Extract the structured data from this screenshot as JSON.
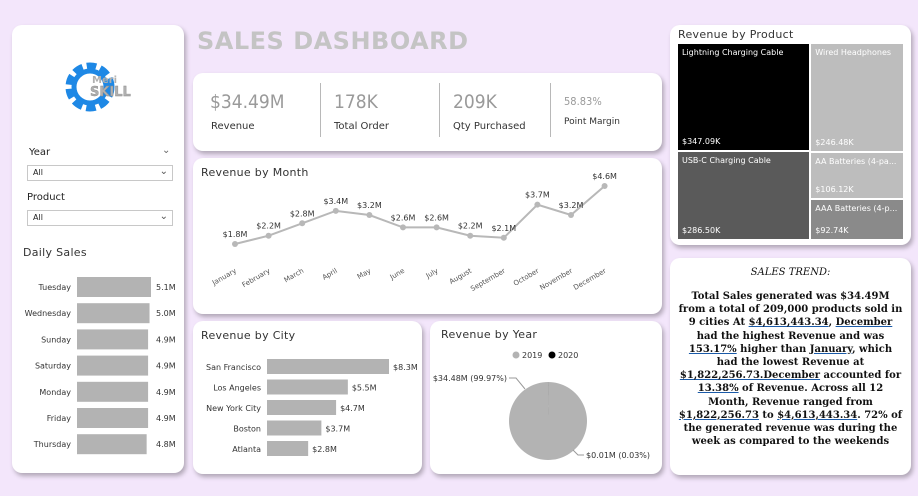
{
  "dashboard": {
    "title": "SALES DASHBOARD"
  },
  "logo": {
    "line1": "Meri",
    "line2": "SKILL"
  },
  "filters": {
    "year": {
      "label": "Year",
      "value": "All"
    },
    "product": {
      "label": "Product",
      "value": "All"
    }
  },
  "kpis": [
    {
      "value": "$34.49M",
      "label": "Revenue"
    },
    {
      "value": "178K",
      "label": "Total Order"
    },
    {
      "value": "209K",
      "label": "Qty Purchased"
    },
    {
      "value": "58.83%",
      "label": "Point Margin"
    }
  ],
  "colors": {
    "bar": "#b3b3b3",
    "line": "#b8b8b8",
    "bg": "#f3e6fb",
    "dark": "#000000",
    "pieMajor": "#b3b3b3",
    "pieMinor": "#000000"
  },
  "trend": {
    "title": "SALES TREND:",
    "segments": [
      {
        "t": "Total Sales generated was $34.49M from a total of 209,000 products sold in 9 cities At "
      },
      {
        "t": "$4,613,443.34",
        "u": true
      },
      {
        "t": ", "
      },
      {
        "t": "December",
        "u": true
      },
      {
        "t": " had the highest Revenue and was "
      },
      {
        "t": "153.17%",
        "u": true
      },
      {
        "t": " higher than "
      },
      {
        "t": "January",
        "u": true
      },
      {
        "t": ", which had the lowest Revenue at "
      },
      {
        "t": "$1,822,256.73.December",
        "u": true
      },
      {
        "t": " accounted for "
      },
      {
        "t": "13.38%",
        "u": true
      },
      {
        "t": " of Revenue. Across all 12 Month, Revenue ranged from "
      },
      {
        "t": "$1,822,256.73",
        "u": true
      },
      {
        "t": " to "
      },
      {
        "t": "$4,613,443.34",
        "u": true
      },
      {
        "t": ". 72% of the generated revenue was during the week as compared to the weekends"
      }
    ]
  },
  "chart_data": [
    {
      "id": "daily",
      "type": "bar",
      "orientation": "horizontal",
      "title": "Daily Sales",
      "categories": [
        "Tuesday",
        "Wednesday",
        "Sunday",
        "Saturday",
        "Monday",
        "Friday",
        "Thursday"
      ],
      "values": [
        5.1,
        5.0,
        4.9,
        4.9,
        4.9,
        4.9,
        4.8
      ],
      "labels": [
        "5.1M",
        "5.0M",
        "4.9M",
        "4.9M",
        "4.9M",
        "4.9M",
        "4.8M"
      ]
    },
    {
      "id": "month",
      "type": "line",
      "title": "Revenue by Month",
      "categories": [
        "January",
        "February",
        "March",
        "April",
        "May",
        "June",
        "July",
        "August",
        "September",
        "October",
        "November",
        "December"
      ],
      "values": [
        1.8,
        2.2,
        2.8,
        3.4,
        3.2,
        2.6,
        2.6,
        2.2,
        2.1,
        3.7,
        3.2,
        4.6
      ],
      "labels": [
        "$1.8M",
        "$2.2M",
        "$2.8M",
        "$3.4M",
        "$3.2M",
        "$2.6M",
        "$2.6M",
        "$2.2M",
        "$2.1M",
        "$3.7M",
        "$3.2M",
        "$4.6M"
      ]
    },
    {
      "id": "city",
      "type": "bar",
      "orientation": "horizontal",
      "title": "Revenue by City",
      "categories": [
        "San Francisco",
        "Los Angeles",
        "New York City",
        "Boston",
        "Atlanta"
      ],
      "values": [
        8.3,
        5.5,
        4.7,
        3.7,
        2.8
      ],
      "labels": [
        "$8.3M",
        "$5.5M",
        "$4.7M",
        "$3.7M",
        "$2.8M"
      ]
    },
    {
      "id": "year",
      "type": "pie",
      "title": "Revenue by Year",
      "legend": [
        "2019",
        "2020"
      ],
      "values": [
        34.48,
        0.01
      ],
      "labels": [
        "$34.48M (99.97%)",
        "$0.01M (0.03%)"
      ]
    },
    {
      "id": "product",
      "type": "treemap",
      "title": "Revenue by Product",
      "items": [
        {
          "name": "Lightning Charging Cable",
          "label": "$347.09K"
        },
        {
          "name": "Wired Headphones",
          "label": "$246.48K"
        },
        {
          "name": "USB-C Charging Cable",
          "label": "$286.50K"
        },
        {
          "name": "AA Batteries (4-pa...",
          "label": "$106.12K"
        },
        {
          "name": "AAA Batteries (4-p...",
          "label": "$92.74K"
        }
      ],
      "values": [
        347.09,
        246.48,
        286.5,
        106.12,
        92.74
      ]
    }
  ]
}
